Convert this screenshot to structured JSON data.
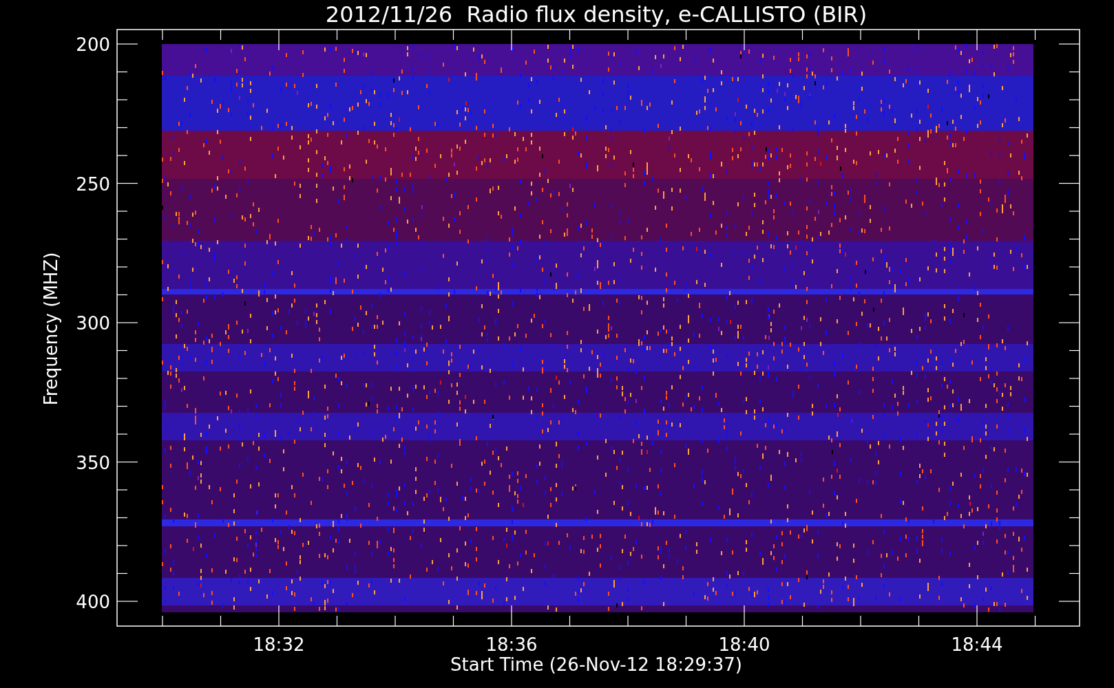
{
  "title": "2012/11/26  Radio flux density, e-CALLISTO (BIR)",
  "y_axis": {
    "label": "Frequency (MHZ)",
    "ticks": [
      "200",
      "250",
      "300",
      "350",
      "400"
    ]
  },
  "x_axis": {
    "label": "Start Time (26-Nov-12 18:29:37)",
    "ticks": [
      "18:32",
      "18:36",
      "18:40",
      "18:44"
    ]
  }
}
